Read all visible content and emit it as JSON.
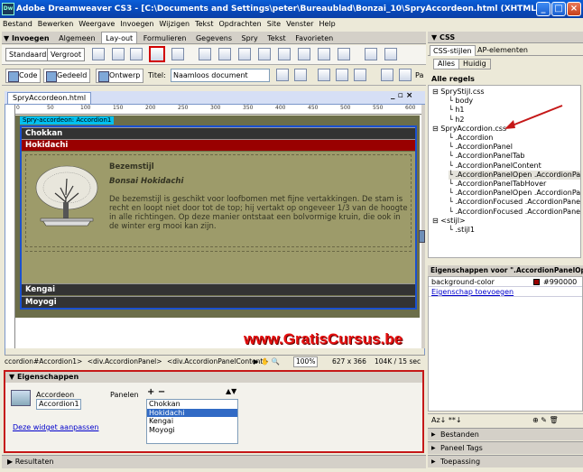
{
  "window": {
    "title": "Adobe Dreamweaver CS3 - [C:\\Documents and Settings\\peter\\Bureaublad\\Bonzai_10\\SpryAccordeon.html (XHTML)]",
    "app_icon": "Dw"
  },
  "menubar": [
    "Bestand",
    "Bewerken",
    "Weergave",
    "Invoegen",
    "Wijzigen",
    "Tekst",
    "Opdrachten",
    "Site",
    "Venster",
    "Help"
  ],
  "insert_panel": {
    "title": "▼ Invoegen",
    "tabs": [
      "Algemeen",
      "Lay-out",
      "Formulieren",
      "Gegevens",
      "Spry",
      "Tekst",
      "Favorieten"
    ],
    "active_tab": "Lay-out",
    "buttons": [
      "Standaard",
      "Vergroot"
    ]
  },
  "document_toolbar": {
    "code": "Code",
    "split": "Gedeeld",
    "design": "Ontwerp",
    "title_label": "Titel:",
    "title_value": "Naamloos document",
    "more": "Pa"
  },
  "document": {
    "tab_name": "SpryAccordeon.html",
    "ruler_ticks": [
      "0",
      "50",
      "100",
      "150",
      "200",
      "250",
      "300",
      "350",
      "400",
      "450",
      "500",
      "550",
      "600"
    ],
    "accordion_label": "Spry-accordeon: Accordion1",
    "panels": [
      "Chokkan",
      "Hokidachi",
      "Kengai",
      "Moyogi"
    ],
    "content": {
      "heading": "Bezemstijl",
      "subheading": "Bonsai Hokidachi",
      "body": "De bezemstijl is geschikt voor loofbomen met fijne vertakkingen. De stam is recht en loopt niet door tot de top; hij vertakt op ongeveer 1/3 van de hoogte in alle richtingen. Op deze manier ontstaat een bolvormige kruin, die ook in de winter erg mooi kan zijn."
    },
    "watermark": "www.GratisCursus.be"
  },
  "statusbar": {
    "tags": [
      "ccordion#Accordion1>",
      "<div.AccordionPanel>",
      "<div.AccordionPanelContent>"
    ],
    "zoom": "100%",
    "dimensions": "627 x 366",
    "size": "104K / 15 sec"
  },
  "properties": {
    "title": "▼ Eigenschappen",
    "widget_type": "Accordeon",
    "widget_name": "Accordion1",
    "panels_label": "Panelen",
    "panels_add_remove": "+ −",
    "panels_move": "▲▼",
    "panel_list": [
      "Chokkan",
      "Hokidachi",
      "Kengai",
      "Moyogi"
    ],
    "selected_panel": "Hokidachi",
    "customize_link": "Deze widget aanpassen"
  },
  "results_label": "Resultaten",
  "css_panel": {
    "title": "▼ CSS",
    "tabs": [
      "CSS-stijlen",
      "AP-elementen"
    ],
    "modes": [
      "Alles",
      "Huidig"
    ],
    "all_rules_label": "Alle regels",
    "tree": [
      {
        "indent": 0,
        "text": "SpryStijl.css",
        "prefix": "⊟"
      },
      {
        "indent": 1,
        "text": "body"
      },
      {
        "indent": 1,
        "text": "h1"
      },
      {
        "indent": 1,
        "text": "h2"
      },
      {
        "indent": 0,
        "text": "SpryAccordion.css",
        "prefix": "⊟"
      },
      {
        "indent": 1,
        "text": ".Accordion"
      },
      {
        "indent": 1,
        "text": ".AccordionPanel"
      },
      {
        "indent": 1,
        "text": ".AccordionPanelTab"
      },
      {
        "indent": 1,
        "text": ".AccordionPanelContent"
      },
      {
        "indent": 1,
        "text": ".AccordionPanelOpen .AccordionPanelTa",
        "selected": true
      },
      {
        "indent": 1,
        "text": ".AccordionPanelTabHover"
      },
      {
        "indent": 1,
        "text": ".AccordionPanelOpen .AccordionPanelTa"
      },
      {
        "indent": 1,
        "text": ".AccordionFocused .AccordionPanelTa"
      },
      {
        "indent": 1,
        "text": ".AccordionFocused .AccordionPanelOpe"
      },
      {
        "indent": 0,
        "text": "<stijl>",
        "prefix": "⊟"
      },
      {
        "indent": 1,
        "text": ".stijl1"
      }
    ],
    "properties_title": "Eigenschappen voor \".AccordionPanelOpen .Acc",
    "property_name": "background-color",
    "property_value": "#990000",
    "add_property": "Eigenschap toevoegen",
    "bottom_toolbar": "Az↓ **↓"
  },
  "right_panels": [
    "Bestanden",
    "Paneel Tags",
    "Toepassing"
  ],
  "colors": {
    "accent_red": "#990000",
    "highlight": "#d10000"
  }
}
